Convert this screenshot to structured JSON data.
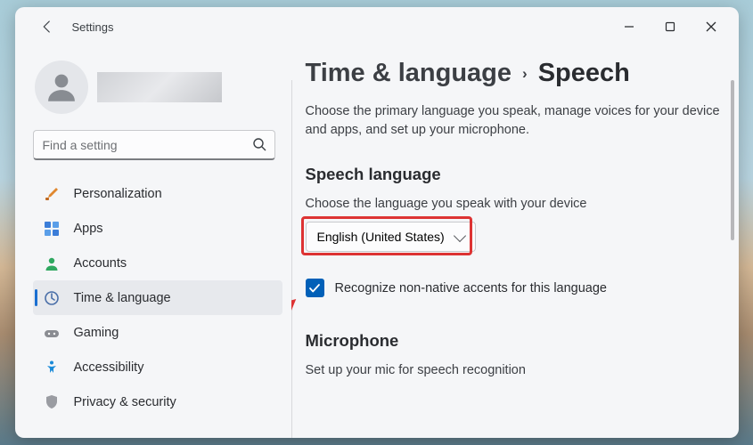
{
  "app": {
    "title": "Settings"
  },
  "search": {
    "placeholder": "Find a setting"
  },
  "nav": {
    "items": [
      {
        "label": "Personalization"
      },
      {
        "label": "Apps"
      },
      {
        "label": "Accounts"
      },
      {
        "label": "Time & language"
      },
      {
        "label": "Gaming"
      },
      {
        "label": "Accessibility"
      },
      {
        "label": "Privacy & security"
      }
    ]
  },
  "breadcrumb": {
    "parent": "Time & language",
    "current": "Speech"
  },
  "intro": "Choose the primary language you speak, manage voices for your device and apps, and set up your microphone.",
  "speech": {
    "heading": "Speech language",
    "sub": "Choose the language you speak with your device",
    "selected": "English (United States)",
    "checkbox_label": "Recognize non-native accents for this language"
  },
  "microphone": {
    "heading": "Microphone",
    "sub": "Set up your mic for speech recognition"
  }
}
